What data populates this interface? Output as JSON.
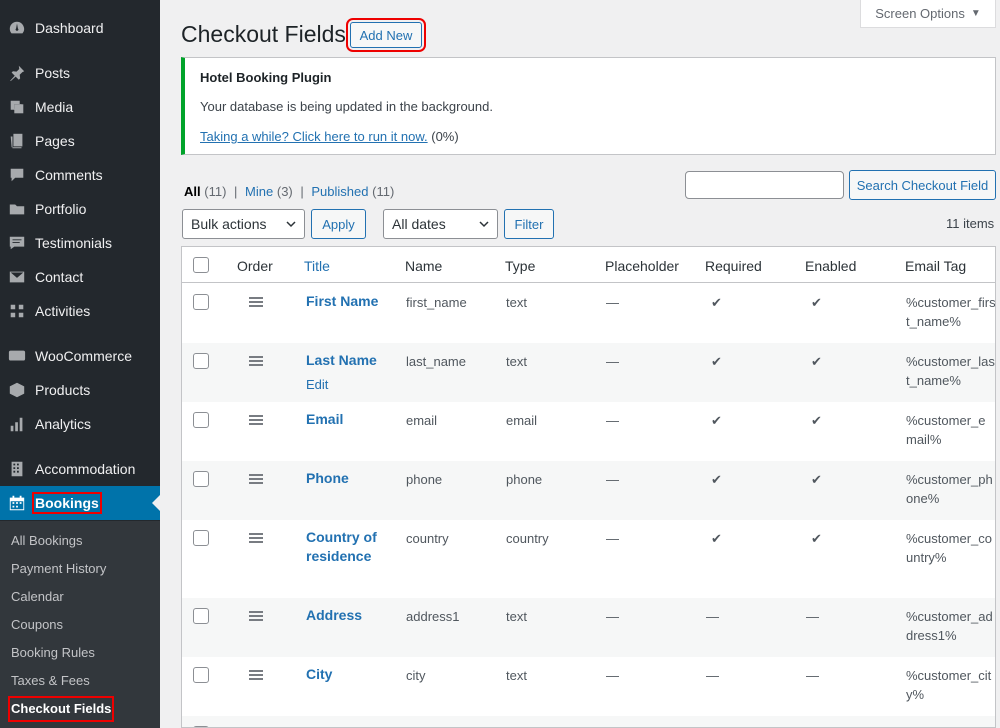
{
  "sidebar": {
    "items": [
      {
        "label": "Dashboard",
        "icon": "dashboard-icon"
      },
      {
        "label": "Posts",
        "icon": "pin-icon"
      },
      {
        "label": "Media",
        "icon": "media-icon"
      },
      {
        "label": "Pages",
        "icon": "pages-icon"
      },
      {
        "label": "Comments",
        "icon": "comment-icon"
      },
      {
        "label": "Portfolio",
        "icon": "folder-icon"
      },
      {
        "label": "Testimonials",
        "icon": "testimonial-icon"
      },
      {
        "label": "Contact",
        "icon": "mail-icon"
      },
      {
        "label": "Activities",
        "icon": "activities-icon"
      },
      {
        "label": "WooCommerce",
        "icon": "woo-icon"
      },
      {
        "label": "Products",
        "icon": "products-icon"
      },
      {
        "label": "Analytics",
        "icon": "analytics-icon"
      },
      {
        "label": "Accommodation",
        "icon": "building-icon"
      },
      {
        "label": "Bookings",
        "icon": "calendar-icon"
      }
    ],
    "submenu": [
      "All Bookings",
      "Payment History",
      "Calendar",
      "Coupons",
      "Booking Rules",
      "Taxes & Fees",
      "Checkout Fields"
    ]
  },
  "header": {
    "title": "Checkout Fields",
    "add_new": "Add New",
    "screen_options": "Screen Options"
  },
  "notice": {
    "title": "Hotel Booking Plugin",
    "message": "Your database is being updated in the background.",
    "link": "Taking a while? Click here to run it now.",
    "progress": "(0%)"
  },
  "filters": {
    "all": "All",
    "all_count": "(11)",
    "mine": "Mine",
    "mine_count": "(3)",
    "published": "Published",
    "published_count": "(11)",
    "sep": "|",
    "search_button": "Search Checkout Field",
    "bulk_actions": "Bulk actions",
    "apply": "Apply",
    "all_dates": "All dates",
    "filter": "Filter",
    "items_count": "11 items"
  },
  "table": {
    "headers": [
      "Order",
      "Title",
      "Name",
      "Type",
      "Placeholder",
      "Required",
      "Enabled",
      "Email Tag"
    ],
    "edit_label": "Edit",
    "rows": [
      {
        "title": "First Name",
        "name": "first_name",
        "type": "text",
        "placeholder": "—",
        "required": "✔",
        "enabled": "✔",
        "email_tag": "%customer_first_name%"
      },
      {
        "title": "Last Name",
        "name": "last_name",
        "type": "text",
        "placeholder": "—",
        "required": "✔",
        "enabled": "✔",
        "email_tag": "%customer_last_name%"
      },
      {
        "title": "Email",
        "name": "email",
        "type": "email",
        "placeholder": "—",
        "required": "✔",
        "enabled": "✔",
        "email_tag": "%customer_email%"
      },
      {
        "title": "Phone",
        "name": "phone",
        "type": "phone",
        "placeholder": "—",
        "required": "✔",
        "enabled": "✔",
        "email_tag": "%customer_phone%"
      },
      {
        "title": "Country of residence",
        "name": "country",
        "type": "country",
        "placeholder": "—",
        "required": "✔",
        "enabled": "✔",
        "email_tag": "%customer_country%"
      },
      {
        "title": "Address",
        "name": "address1",
        "type": "text",
        "placeholder": "—",
        "required": "—",
        "enabled": "—",
        "email_tag": "%customer_address1%"
      },
      {
        "title": "City",
        "name": "city",
        "type": "text",
        "placeholder": "—",
        "required": "—",
        "enabled": "—",
        "email_tag": "%customer_city%"
      }
    ]
  },
  "colors": {
    "sidebar_bg": "#23282d",
    "active_bg": "#0073aa",
    "link": "#2271b1",
    "notice_border": "#00a32a",
    "highlight": "#ee0000"
  }
}
